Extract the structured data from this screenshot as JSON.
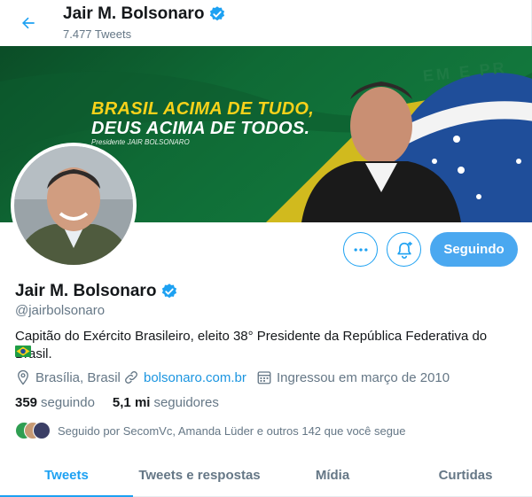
{
  "header": {
    "title": "Jair M. Bolsonaro",
    "tweet_count": "7.477 Tweets"
  },
  "banner": {
    "line1": "BRASIL ACIMA DE TUDO,",
    "line2": "DEUS ACIMA DE TODOS.",
    "signature": "Presidente JAIR BOLSONARO",
    "motto": "EM E PR"
  },
  "actions": {
    "following_label": "Seguindo"
  },
  "profile": {
    "name": "Jair M. Bolsonaro",
    "handle": "@jairbolsonaro",
    "bio": "Capitão do Exército Brasileiro, eleito 38° Presidente da República Federativa do Brasil.",
    "location": "Brasília, Brasil",
    "website": "bolsonaro.com.br",
    "joined": "Ingressou em março de 2010",
    "following_count": "359",
    "following_label": "seguindo",
    "followers_count": "5,1 mi",
    "followers_label": "seguidores",
    "followed_by": "Seguido por SecomVc, Amanda Lüder e outros 142 que você segue"
  },
  "tabs": [
    {
      "label": "Tweets"
    },
    {
      "label": "Tweets e respostas"
    },
    {
      "label": "Mídia"
    },
    {
      "label": "Curtidas"
    }
  ],
  "colors": {
    "accent": "#1da1f2",
    "following_button": "#4aa8f0",
    "secondary_text": "#657786",
    "banner_green": "#0c5a2e",
    "banner_yellow": "#f7d21a"
  },
  "icons": [
    "back-arrow-icon",
    "verified-badge-icon",
    "more-icon",
    "bell-plus-icon",
    "location-icon",
    "link-icon",
    "calendar-icon",
    "brazil-flag-icon"
  ]
}
